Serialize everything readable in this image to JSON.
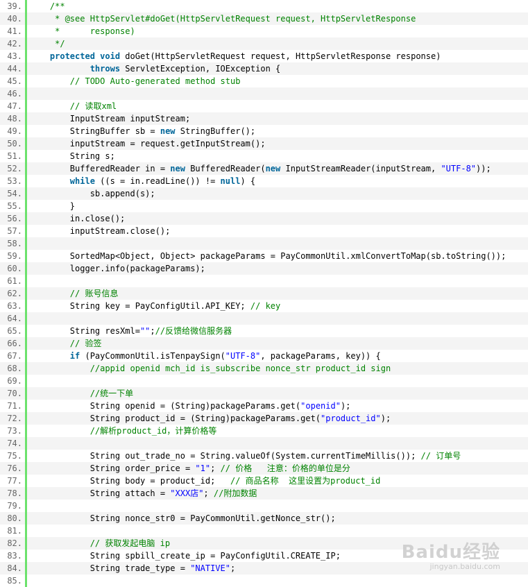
{
  "colors": {
    "keyword": "#006699",
    "comment": "#008200",
    "string": "#0000ff",
    "gutter_bar": "#6ce26c",
    "line_alt_bg": "#f4f4f4"
  },
  "code_lines": [
    {
      "num": "39.",
      "tokens": [
        [
          "pl",
          "    "
        ],
        [
          "cm",
          "/**"
        ]
      ]
    },
    {
      "num": "40.",
      "tokens": [
        [
          "cm",
          "     * @see HttpServlet#doGet(HttpServletRequest request, HttpServletResponse"
        ]
      ]
    },
    {
      "num": "41.",
      "tokens": [
        [
          "cm",
          "     *      response)"
        ]
      ]
    },
    {
      "num": "42.",
      "tokens": [
        [
          "cm",
          "     */"
        ]
      ]
    },
    {
      "num": "43.",
      "tokens": [
        [
          "pl",
          "    "
        ],
        [
          "kw",
          "protected"
        ],
        [
          "pl",
          " "
        ],
        [
          "kw",
          "void"
        ],
        [
          "pl",
          " doGet(HttpServletRequest request, HttpServletResponse response)"
        ]
      ]
    },
    {
      "num": "44.",
      "tokens": [
        [
          "pl",
          "            "
        ],
        [
          "kw",
          "throws"
        ],
        [
          "pl",
          " ServletException, IOException {"
        ]
      ]
    },
    {
      "num": "45.",
      "tokens": [
        [
          "pl",
          "        "
        ],
        [
          "cm",
          "// TODO Auto-generated method stub"
        ]
      ]
    },
    {
      "num": "46.",
      "tokens": []
    },
    {
      "num": "47.",
      "tokens": [
        [
          "pl",
          "        "
        ],
        [
          "cm",
          "// 读取xml"
        ]
      ]
    },
    {
      "num": "48.",
      "tokens": [
        [
          "pl",
          "        InputStream inputStream;"
        ]
      ]
    },
    {
      "num": "49.",
      "tokens": [
        [
          "pl",
          "        StringBuffer sb = "
        ],
        [
          "kw",
          "new"
        ],
        [
          "pl",
          " StringBuffer();"
        ]
      ]
    },
    {
      "num": "50.",
      "tokens": [
        [
          "pl",
          "        inputStream = request.getInputStream();"
        ]
      ]
    },
    {
      "num": "51.",
      "tokens": [
        [
          "pl",
          "        String s;"
        ]
      ]
    },
    {
      "num": "52.",
      "tokens": [
        [
          "pl",
          "        BufferedReader in = "
        ],
        [
          "kw",
          "new"
        ],
        [
          "pl",
          " BufferedReader("
        ],
        [
          "kw",
          "new"
        ],
        [
          "pl",
          " InputStreamReader(inputStream, "
        ],
        [
          "st",
          "\"UTF-8\""
        ],
        [
          "pl",
          "));"
        ]
      ]
    },
    {
      "num": "53.",
      "tokens": [
        [
          "pl",
          "        "
        ],
        [
          "kw",
          "while"
        ],
        [
          "pl",
          " ((s = in.readLine()) != "
        ],
        [
          "kw",
          "null"
        ],
        [
          "pl",
          ") {"
        ]
      ]
    },
    {
      "num": "54.",
      "tokens": [
        [
          "pl",
          "            sb.append(s);"
        ]
      ]
    },
    {
      "num": "55.",
      "tokens": [
        [
          "pl",
          "        }"
        ]
      ]
    },
    {
      "num": "56.",
      "tokens": [
        [
          "pl",
          "        in.close();"
        ]
      ]
    },
    {
      "num": "57.",
      "tokens": [
        [
          "pl",
          "        inputStream.close();"
        ]
      ]
    },
    {
      "num": "58.",
      "tokens": []
    },
    {
      "num": "59.",
      "tokens": [
        [
          "pl",
          "        SortedMap<Object, Object> packageParams = PayCommonUtil.xmlConvertToMap(sb.toString());"
        ]
      ]
    },
    {
      "num": "60.",
      "tokens": [
        [
          "pl",
          "        logger.info(packageParams);"
        ]
      ]
    },
    {
      "num": "61.",
      "tokens": []
    },
    {
      "num": "62.",
      "tokens": [
        [
          "pl",
          "        "
        ],
        [
          "cm",
          "// 账号信息"
        ]
      ]
    },
    {
      "num": "63.",
      "tokens": [
        [
          "pl",
          "        String key = PayConfigUtil.API_KEY; "
        ],
        [
          "cm",
          "// key"
        ]
      ]
    },
    {
      "num": "64.",
      "tokens": []
    },
    {
      "num": "65.",
      "tokens": [
        [
          "pl",
          "        String resXml="
        ],
        [
          "st",
          "\"\""
        ],
        [
          "pl",
          ";"
        ],
        [
          "cm",
          "//反馈给微信服务器"
        ]
      ]
    },
    {
      "num": "66.",
      "tokens": [
        [
          "pl",
          "        "
        ],
        [
          "cm",
          "// 验签"
        ]
      ]
    },
    {
      "num": "67.",
      "tokens": [
        [
          "pl",
          "        "
        ],
        [
          "kw",
          "if"
        ],
        [
          "pl",
          " (PayCommonUtil.isTenpaySign("
        ],
        [
          "st",
          "\"UTF-8\""
        ],
        [
          "pl",
          ", packageParams, key)) {"
        ]
      ]
    },
    {
      "num": "68.",
      "tokens": [
        [
          "pl",
          "            "
        ],
        [
          "cm",
          "//appid openid mch_id is_subscribe nonce_str product_id sign"
        ]
      ]
    },
    {
      "num": "69.",
      "tokens": []
    },
    {
      "num": "70.",
      "tokens": [
        [
          "pl",
          "            "
        ],
        [
          "cm",
          "//统一下单"
        ]
      ]
    },
    {
      "num": "71.",
      "tokens": [
        [
          "pl",
          "            String openid = (String)packageParams.get("
        ],
        [
          "st",
          "\"openid\""
        ],
        [
          "pl",
          ");"
        ]
      ]
    },
    {
      "num": "72.",
      "tokens": [
        [
          "pl",
          "            String product_id = (String)packageParams.get("
        ],
        [
          "st",
          "\"product_id\""
        ],
        [
          "pl",
          ");"
        ]
      ]
    },
    {
      "num": "73.",
      "tokens": [
        [
          "pl",
          "            "
        ],
        [
          "cm",
          "//解析product_id，计算价格等"
        ]
      ]
    },
    {
      "num": "74.",
      "tokens": []
    },
    {
      "num": "75.",
      "tokens": [
        [
          "pl",
          "            String out_trade_no = String.valueOf(System.currentTimeMillis()); "
        ],
        [
          "cm",
          "// 订单号"
        ]
      ]
    },
    {
      "num": "76.",
      "tokens": [
        [
          "pl",
          "            String order_price = "
        ],
        [
          "st",
          "\"1\""
        ],
        [
          "pl",
          "; "
        ],
        [
          "cm",
          "// 价格   注意：价格的单位是分"
        ]
      ]
    },
    {
      "num": "77.",
      "tokens": [
        [
          "pl",
          "            String body = product_id;   "
        ],
        [
          "cm",
          "// 商品名称  这里设置为product_id"
        ]
      ]
    },
    {
      "num": "78.",
      "tokens": [
        [
          "pl",
          "            String attach = "
        ],
        [
          "st",
          "\"XXX店\""
        ],
        [
          "pl",
          "; "
        ],
        [
          "cm",
          "//附加数据"
        ]
      ]
    },
    {
      "num": "79.",
      "tokens": []
    },
    {
      "num": "80.",
      "tokens": [
        [
          "pl",
          "            String nonce_str0 = PayCommonUtil.getNonce_str();"
        ]
      ]
    },
    {
      "num": "81.",
      "tokens": []
    },
    {
      "num": "82.",
      "tokens": [
        [
          "pl",
          "            "
        ],
        [
          "cm",
          "// 获取发起电脑 ip"
        ]
      ]
    },
    {
      "num": "83.",
      "tokens": [
        [
          "pl",
          "            String spbill_create_ip = PayConfigUtil.CREATE_IP;"
        ]
      ]
    },
    {
      "num": "84.",
      "tokens": [
        [
          "pl",
          "            String trade_type = "
        ],
        [
          "st",
          "\"NATIVE\""
        ],
        [
          "pl",
          ";"
        ]
      ]
    },
    {
      "num": "85.",
      "tokens": []
    }
  ],
  "watermark": {
    "logo": "Baidu经验",
    "url": "jingyan.baidu.com"
  }
}
